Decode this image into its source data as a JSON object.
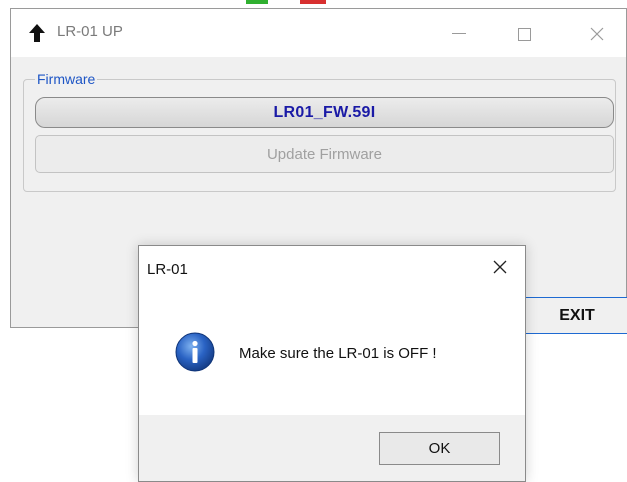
{
  "app_window": {
    "title": "LR-01 UP",
    "group_label": "Firmware",
    "firmware_version": "LR01_FW.59I",
    "update_button_label": "Update Firmware",
    "exit_button_label": "EXIT"
  },
  "dialog": {
    "title": "LR-01",
    "message": "Make sure the LR-01 is OFF !",
    "ok_button_label": "OK",
    "icon": "info-icon"
  },
  "colors": {
    "firmware_text": "#1a1aa6",
    "group_label": "#1d55c5",
    "exit_focus_border": "#1e6ad2",
    "info_icon": "#2a63c4"
  }
}
